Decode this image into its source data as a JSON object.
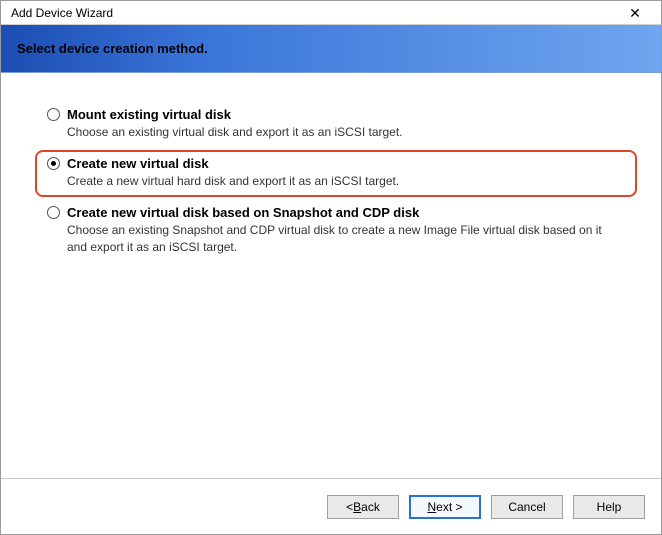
{
  "window": {
    "title": "Add Device Wizard",
    "close_glyph": "✕"
  },
  "banner": {
    "heading": "Select device creation method."
  },
  "options": [
    {
      "title": "Mount existing virtual disk",
      "desc": "Choose an existing virtual disk and export it as an iSCSI target.",
      "selected": false,
      "highlight": false
    },
    {
      "title": "Create new virtual disk",
      "desc": "Create a new virtual hard disk and export it as an iSCSI target.",
      "selected": true,
      "highlight": true
    },
    {
      "title": "Create new virtual disk based on Snapshot and CDP disk",
      "desc": "Choose an existing Snapshot and CDP virtual disk to create a new Image File virtual disk based on it and export it as an iSCSI target.",
      "selected": false,
      "highlight": false
    }
  ],
  "footer": {
    "back_prefix": "< ",
    "back_mn": "B",
    "back_suffix": "ack",
    "next_mn": "N",
    "next_suffix": "ext >",
    "cancel": "Cancel",
    "help": "Help"
  }
}
